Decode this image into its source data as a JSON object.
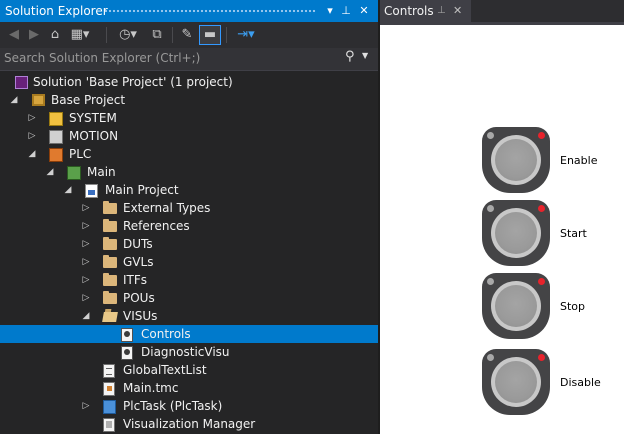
{
  "solution_explorer": {
    "title": "Solution Explorer",
    "title_buttons": {
      "dropdown": "▾",
      "pin": "⊥",
      "close": "✕"
    },
    "search": {
      "placeholder": "Search Solution Explorer (Ctrl+;)"
    },
    "tree": [
      {
        "label": "Solution 'Base Project' (1 project)",
        "icon": "solution-icon",
        "expander": "none"
      },
      {
        "label": "Base Project",
        "icon": "project-icon",
        "expander": "expanded"
      },
      {
        "label": "SYSTEM",
        "icon": "system-icon",
        "expander": "collapsed"
      },
      {
        "label": "MOTION",
        "icon": "motion-icon",
        "expander": "collapsed"
      },
      {
        "label": "PLC",
        "icon": "plc-icon",
        "expander": "expanded"
      },
      {
        "label": "Main",
        "icon": "main-icon",
        "expander": "expanded"
      },
      {
        "label": "Main Project",
        "icon": "plc-project-icon",
        "expander": "expanded"
      },
      {
        "label": "External Types",
        "icon": "folder-icon",
        "expander": "collapsed"
      },
      {
        "label": "References",
        "icon": "folder-icon",
        "expander": "collapsed"
      },
      {
        "label": "DUTs",
        "icon": "folder-icon",
        "expander": "collapsed"
      },
      {
        "label": "GVLs",
        "icon": "folder-icon",
        "expander": "collapsed"
      },
      {
        "label": "ITFs",
        "icon": "folder-icon",
        "expander": "collapsed"
      },
      {
        "label": "POUs",
        "icon": "folder-icon",
        "expander": "collapsed"
      },
      {
        "label": "VISUs",
        "icon": "folder-open-icon",
        "expander": "expanded"
      },
      {
        "label": "Controls",
        "icon": "visu-icon",
        "expander": "none",
        "selected": true
      },
      {
        "label": "DiagnosticVisu",
        "icon": "visu-icon",
        "expander": "none"
      },
      {
        "label": "GlobalTextList",
        "icon": "text-list-icon",
        "expander": "none"
      },
      {
        "label": "Main.tmc",
        "icon": "tmc-file-icon",
        "expander": "none"
      },
      {
        "label": "PlcTask (PlcTask)",
        "icon": "plc-task-icon",
        "expander": "collapsed"
      },
      {
        "label": "Visualization Manager",
        "icon": "visualization-manager-icon",
        "expander": "none"
      }
    ]
  },
  "controls_tab": {
    "label": "Controls",
    "pin": "⊥",
    "close": "✕"
  },
  "visualization": {
    "buttons": [
      {
        "label": "Enable"
      },
      {
        "label": "Start"
      },
      {
        "label": "Stop"
      },
      {
        "label": "Disable"
      }
    ]
  },
  "colors": {
    "accent": "#007acc",
    "led_active": "#e8232c",
    "led_idle": "#a8a8a8",
    "button_housing": "#444446"
  }
}
